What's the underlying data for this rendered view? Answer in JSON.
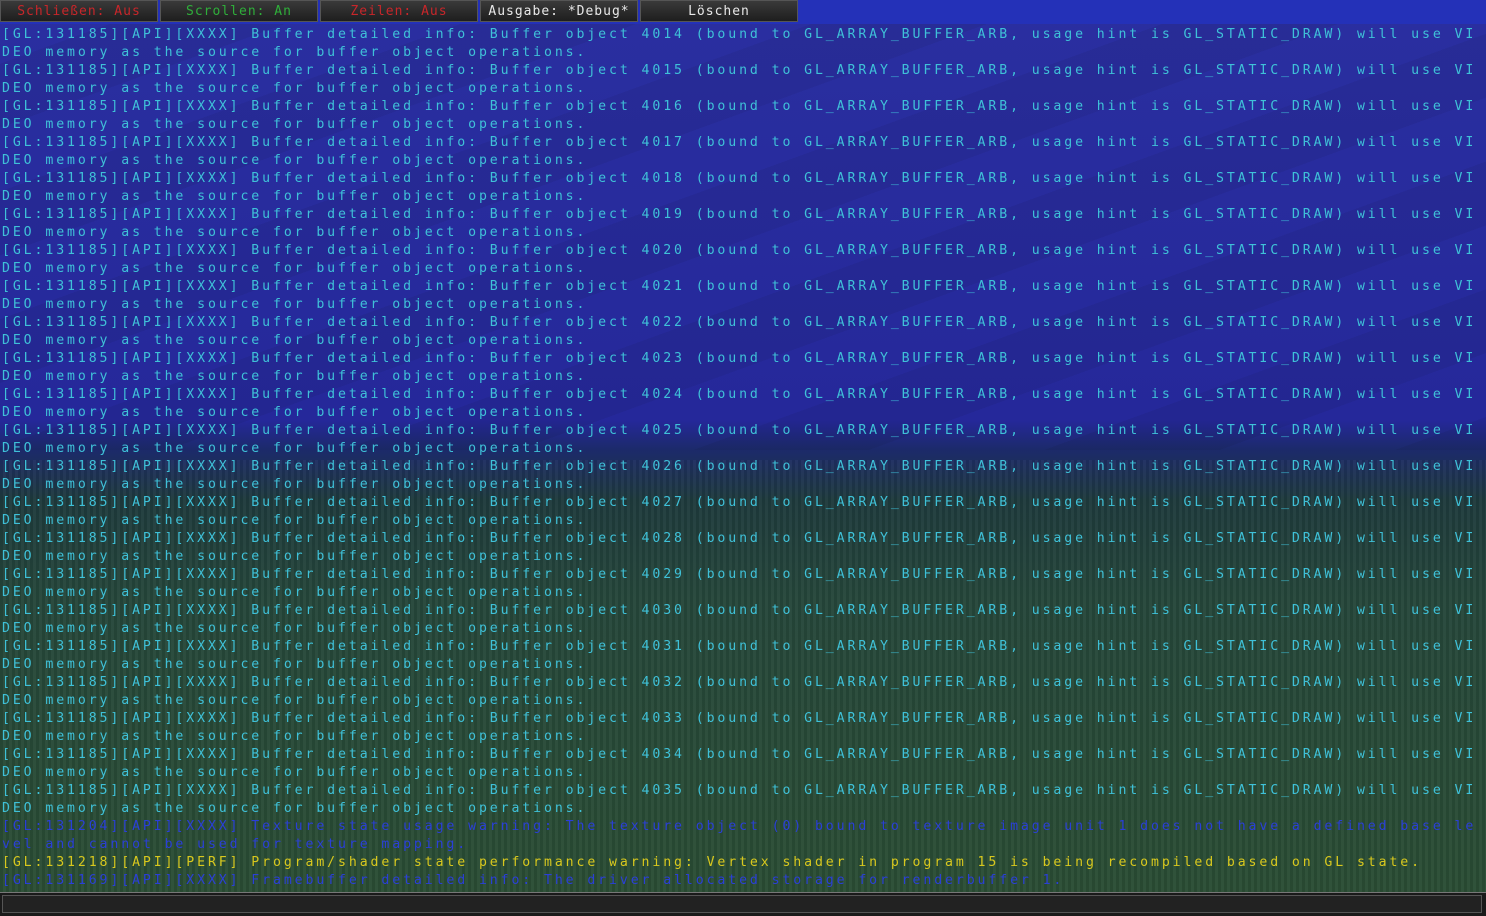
{
  "toolbar": {
    "buttons": [
      {
        "label": "Schließen: Aus",
        "color": "#c8262a"
      },
      {
        "label": "Scrollen: An",
        "color": "#2fae3a"
      },
      {
        "label": "Zeilen: Aus",
        "color": "#c8262a"
      },
      {
        "label": "Ausgabe: *Debug*",
        "color": "#e8e8e8"
      },
      {
        "label": "Löschen",
        "color": "#e8e8e8"
      }
    ]
  },
  "log": {
    "lines": [
      {
        "text": "[GL:131185][API][XXXX] Buffer detailed info: Buffer object 4014 (bound to GL_ARRAY_BUFFER_ARB, usage hint is GL_STATIC_DRAW) will use VIDEO memory as the source for buffer object operations.",
        "color": "#3fc1d8"
      },
      {
        "text": "[GL:131185][API][XXXX] Buffer detailed info: Buffer object 4015 (bound to GL_ARRAY_BUFFER_ARB, usage hint is GL_STATIC_DRAW) will use VIDEO memory as the source for buffer object operations.",
        "color": "#3fc1d8"
      },
      {
        "text": "[GL:131185][API][XXXX] Buffer detailed info: Buffer object 4016 (bound to GL_ARRAY_BUFFER_ARB, usage hint is GL_STATIC_DRAW) will use VIDEO memory as the source for buffer object operations.",
        "color": "#3fc1d8"
      },
      {
        "text": "[GL:131185][API][XXXX] Buffer detailed info: Buffer object 4017 (bound to GL_ARRAY_BUFFER_ARB, usage hint is GL_STATIC_DRAW) will use VIDEO memory as the source for buffer object operations.",
        "color": "#3fc1d8"
      },
      {
        "text": "[GL:131185][API][XXXX] Buffer detailed info: Buffer object 4018 (bound to GL_ARRAY_BUFFER_ARB, usage hint is GL_STATIC_DRAW) will use VIDEO memory as the source for buffer object operations.",
        "color": "#3fc1d8"
      },
      {
        "text": "[GL:131185][API][XXXX] Buffer detailed info: Buffer object 4019 (bound to GL_ARRAY_BUFFER_ARB, usage hint is GL_STATIC_DRAW) will use VIDEO memory as the source for buffer object operations.",
        "color": "#3fc1d8"
      },
      {
        "text": "[GL:131185][API][XXXX] Buffer detailed info: Buffer object 4020 (bound to GL_ARRAY_BUFFER_ARB, usage hint is GL_STATIC_DRAW) will use VIDEO memory as the source for buffer object operations.",
        "color": "#3fc1d8"
      },
      {
        "text": "[GL:131185][API][XXXX] Buffer detailed info: Buffer object 4021 (bound to GL_ARRAY_BUFFER_ARB, usage hint is GL_STATIC_DRAW) will use VIDEO memory as the source for buffer object operations.",
        "color": "#3fc1d8"
      },
      {
        "text": "[GL:131185][API][XXXX] Buffer detailed info: Buffer object 4022 (bound to GL_ARRAY_BUFFER_ARB, usage hint is GL_STATIC_DRAW) will use VIDEO memory as the source for buffer object operations.",
        "color": "#3fc1d8"
      },
      {
        "text": "[GL:131185][API][XXXX] Buffer detailed info: Buffer object 4023 (bound to GL_ARRAY_BUFFER_ARB, usage hint is GL_STATIC_DRAW) will use VIDEO memory as the source for buffer object operations.",
        "color": "#3fc1d8"
      },
      {
        "text": "[GL:131185][API][XXXX] Buffer detailed info: Buffer object 4024 (bound to GL_ARRAY_BUFFER_ARB, usage hint is GL_STATIC_DRAW) will use VIDEO memory as the source for buffer object operations.",
        "color": "#3fc1d8"
      },
      {
        "text": "[GL:131185][API][XXXX] Buffer detailed info: Buffer object 4025 (bound to GL_ARRAY_BUFFER_ARB, usage hint is GL_STATIC_DRAW) will use VIDEO memory as the source for buffer object operations.",
        "color": "#3fc1d8"
      },
      {
        "text": "[GL:131185][API][XXXX] Buffer detailed info: Buffer object 4026 (bound to GL_ARRAY_BUFFER_ARB, usage hint is GL_STATIC_DRAW) will use VIDEO memory as the source for buffer object operations.",
        "color": "#3fc1d8"
      },
      {
        "text": "[GL:131185][API][XXXX] Buffer detailed info: Buffer object 4027 (bound to GL_ARRAY_BUFFER_ARB, usage hint is GL_STATIC_DRAW) will use VIDEO memory as the source for buffer object operations.",
        "color": "#3fc1d8"
      },
      {
        "text": "[GL:131185][API][XXXX] Buffer detailed info: Buffer object 4028 (bound to GL_ARRAY_BUFFER_ARB, usage hint is GL_STATIC_DRAW) will use VIDEO memory as the source for buffer object operations.",
        "color": "#3fc1d8"
      },
      {
        "text": "[GL:131185][API][XXXX] Buffer detailed info: Buffer object 4029 (bound to GL_ARRAY_BUFFER_ARB, usage hint is GL_STATIC_DRAW) will use VIDEO memory as the source for buffer object operations.",
        "color": "#3fc1d8"
      },
      {
        "text": "[GL:131185][API][XXXX] Buffer detailed info: Buffer object 4030 (bound to GL_ARRAY_BUFFER_ARB, usage hint is GL_STATIC_DRAW) will use VIDEO memory as the source for buffer object operations.",
        "color": "#3fc1d8"
      },
      {
        "text": "[GL:131185][API][XXXX] Buffer detailed info: Buffer object 4031 (bound to GL_ARRAY_BUFFER_ARB, usage hint is GL_STATIC_DRAW) will use VIDEO memory as the source for buffer object operations.",
        "color": "#3fc1d8"
      },
      {
        "text": "[GL:131185][API][XXXX] Buffer detailed info: Buffer object 4032 (bound to GL_ARRAY_BUFFER_ARB, usage hint is GL_STATIC_DRAW) will use VIDEO memory as the source for buffer object operations.",
        "color": "#3fc1d8"
      },
      {
        "text": "[GL:131185][API][XXXX] Buffer detailed info: Buffer object 4033 (bound to GL_ARRAY_BUFFER_ARB, usage hint is GL_STATIC_DRAW) will use VIDEO memory as the source for buffer object operations.",
        "color": "#3fc1d8"
      },
      {
        "text": "[GL:131185][API][XXXX] Buffer detailed info: Buffer object 4034 (bound to GL_ARRAY_BUFFER_ARB, usage hint is GL_STATIC_DRAW) will use VIDEO memory as the source for buffer object operations.",
        "color": "#3fc1d8"
      },
      {
        "text": "[GL:131185][API][XXXX] Buffer detailed info: Buffer object 4035 (bound to GL_ARRAY_BUFFER_ARB, usage hint is GL_STATIC_DRAW) will use VIDEO memory as the source for buffer object operations.",
        "color": "#3fc1d8"
      },
      {
        "text": "[GL:131204][API][XXXX] Texture state usage warning: The texture object (0) bound to texture image unit 1 does not have a defined base level and cannot be used for texture mapping.",
        "color": "#2a3fd8"
      },
      {
        "text": "[GL:131218][API][PERF] Program/shader state performance warning: Vertex shader in program 15 is being recompiled based on GL state.",
        "color": "#d8c81e"
      },
      {
        "text": "[GL:131169][API][XXXX] Framebuffer detailed info: The driver allocated storage for renderbuffer 1.",
        "color": "#2a3fd8"
      }
    ]
  },
  "statusbar": {
    "input_value": ""
  }
}
